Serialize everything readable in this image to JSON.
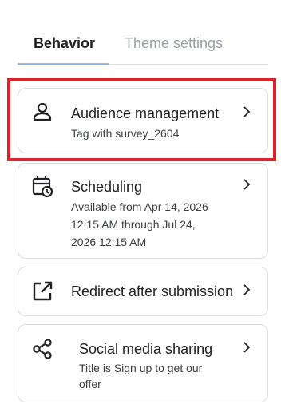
{
  "tabs": {
    "behavior": "Behavior",
    "theme_settings": "Theme settings"
  },
  "cards": {
    "audience": {
      "title": "Audience management",
      "subtitle": "Tag with survey_2604",
      "icon": "person-icon"
    },
    "scheduling": {
      "title": "Scheduling",
      "line1": "Available from Apr 14, 2026",
      "line2": "12:15 AM through Jul 24,",
      "line3": "2026 12:15 AM",
      "icon": "calendar-clock-icon"
    },
    "redirect": {
      "title": "Redirect after submission",
      "icon": "open-in-new-icon"
    },
    "social": {
      "title": "Social media sharing",
      "line1": "Title is Sign up to get our",
      "line2": "offer",
      "icon": "share-icon"
    }
  },
  "colors": {
    "highlight": "#d9232d",
    "border": "#dadce0",
    "text": "#202124",
    "muted_tab": "#9aa0a6"
  }
}
